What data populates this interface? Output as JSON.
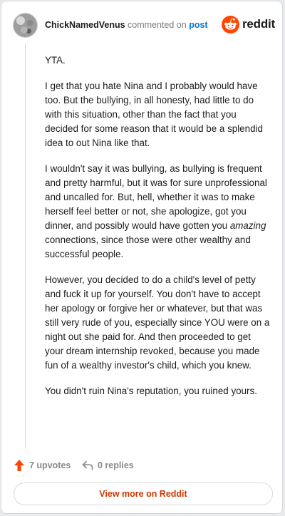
{
  "header": {
    "username": "ChickNamedVenus",
    "commented_text": "commented on",
    "post_link": "post",
    "brand": "reddit"
  },
  "comment": {
    "paragraphs": [
      {
        "text": "YTA."
      },
      {
        "text": "I get that you hate Nina and I probably would have too. But the bullying, in all honesty, had little to do with this situation, other than the fact that you decided for some reason that it would be a splendid idea to out Nina like that."
      },
      {
        "before": "I wouldn't say it was bullying, as bullying is frequent and pretty harmful, but it was for sure unprofessional and uncalled for. But, hell, whether it was to make herself feel better or not, she apologize, got you dinner, and possibly would have gotten you ",
        "em": "amazing",
        "after": " connections, since those were other wealthy and successful people."
      },
      {
        "text": "However, you decided to do a child's level of petty and fuck it up for yourself. You don't have to accept her apology or forgive her or whatever, but that was still very rude of you, especially since YOU were on a night out she paid for. And then proceeded to get your dream internship revoked, because you made fun of a wealthy investor's child, which you knew."
      },
      {
        "text": "You didn't ruin Nina's reputation, you ruined yours."
      }
    ]
  },
  "actions": {
    "upvotes": "7 upvotes",
    "replies": "0 replies",
    "upvote_icon": "upvote-arrow-icon",
    "reply_icon": "reply-arrow-icon"
  },
  "footer": {
    "view_more": "View more on Reddit"
  },
  "colors": {
    "brand_orange": "#ff4500",
    "link_blue": "#0079d3",
    "view_more_text": "#cc3700"
  }
}
